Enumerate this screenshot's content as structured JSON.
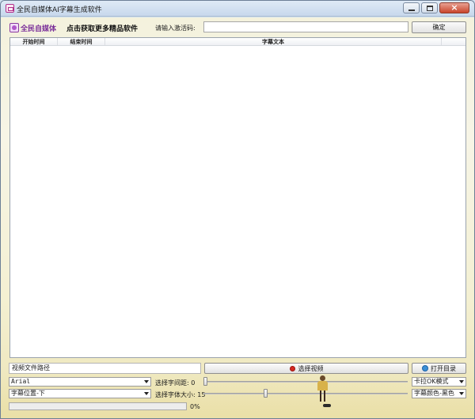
{
  "window": {
    "title": "全民自媒体AI字幕生成软件"
  },
  "header": {
    "logo_text": "全民自媒体",
    "promo_link": "点击获取更多精品软件",
    "code_label": "请输入激活码:",
    "code_value": "",
    "confirm_label": "确定"
  },
  "table": {
    "columns": [
      "开始时间",
      "结束时间",
      "字幕文本"
    ],
    "rows": []
  },
  "controls": {
    "video_path_value": "视频文件路径",
    "select_video_label": "选择视频",
    "open_dir_label": "打开目录",
    "font_select": "Arial",
    "position_select": "字幕位置-下",
    "spacing_label": "选择字间距: 0",
    "spacing_value": 0,
    "size_label": "选择字体大小: 15",
    "size_value": 15,
    "karaoke_select": "卡拉OK模式",
    "color_select": "字幕颜色-黑色",
    "progress_percent": 0,
    "progress_label": "0%"
  }
}
